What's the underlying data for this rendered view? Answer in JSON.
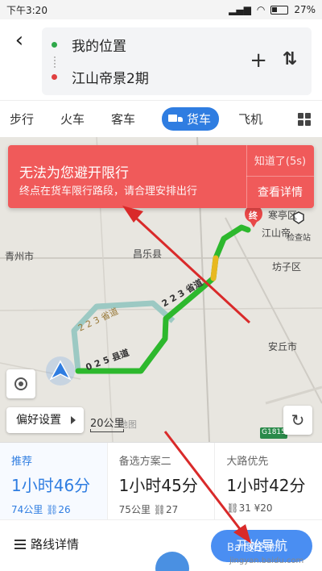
{
  "status": {
    "time": "下午3:20",
    "battery": "27%"
  },
  "header": {
    "origin": "我的位置",
    "destination": "江山帝景2期",
    "origin_color": "#2ea84a",
    "destination_color": "#e04040"
  },
  "tabs": [
    {
      "label": "步行"
    },
    {
      "label": "火车"
    },
    {
      "label": "客车"
    },
    {
      "label": "货车",
      "active": true
    },
    {
      "label": "飞机"
    }
  ],
  "alert": {
    "title": "无法为您避开限行",
    "description": "终点在货车限行路段，请合理安排出行",
    "dismiss": "知道了(5s)",
    "details": "查看详情",
    "color": "#f05a5a"
  },
  "map": {
    "labels": {
      "qingzhou": "青州市",
      "changle": "昌乐县",
      "fangzi": "坊子区",
      "anqiu": "安丘市",
      "jiangshan": "江山帝",
      "hanting": "寒亭区",
      "checkpoint": "检查站",
      "road1": "2 2 3 省道",
      "road2": "0 2 5 县道",
      "road3": "2 2 3 省道",
      "highway": "G1815",
      "ditu": "地图"
    },
    "scale": "20公里",
    "route_color": "#2db82d"
  },
  "controls": {
    "preference": "偏好设置"
  },
  "routes": [
    {
      "tag": "推荐",
      "time": "1小时46分",
      "meta": "74公里 ⛓26",
      "selected": true
    },
    {
      "tag": "备选方案二",
      "time": "1小时45分",
      "meta": "75公里 ⛓27",
      "selected": false
    },
    {
      "tag": "大路优先",
      "time": "1小时42分",
      "meta": "⛓31 ¥20",
      "selected": false
    }
  ],
  "bottom": {
    "details": "路线详情",
    "navigate": "开始导航",
    "watermark": "Bai度经验",
    "watermark_url": "jingyan.baidu.com"
  }
}
